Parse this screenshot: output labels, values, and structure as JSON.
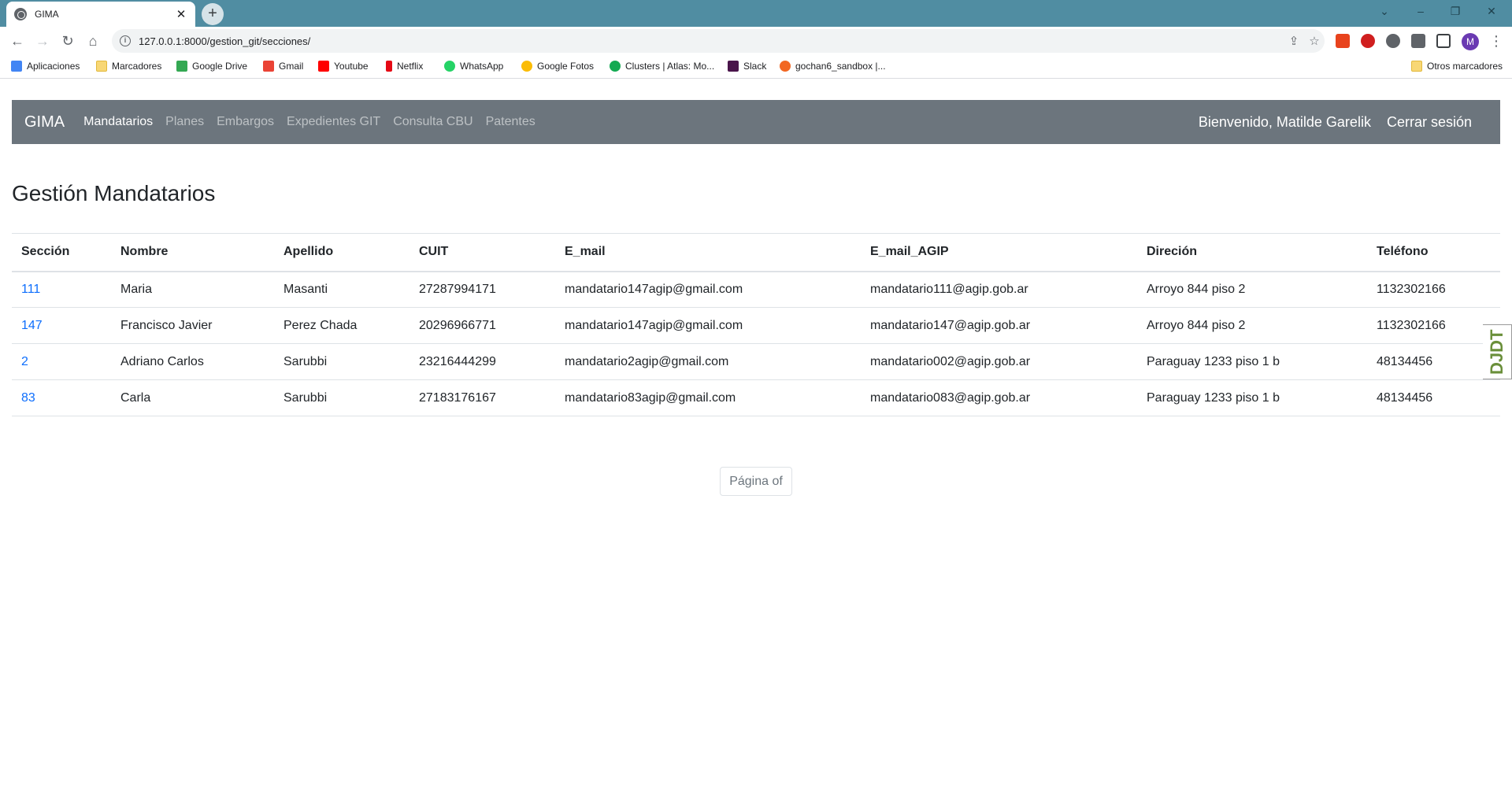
{
  "browser": {
    "tab_title": "GIMA",
    "tab_close": "✕",
    "new_tab": "+",
    "url": "127.0.0.1:8000/gestion_git/secciones/",
    "profile_initial": "M",
    "bookmarks": [
      {
        "label": "Aplicaciones",
        "icon": "apps-grid-icon",
        "color": "#4285f4"
      },
      {
        "label": "Marcadores",
        "icon": "folder-icon",
        "color": "#f8d775"
      },
      {
        "label": "Google Drive",
        "icon": "google-drive-icon",
        "color": "#34a853"
      },
      {
        "label": "Gmail",
        "icon": "gmail-icon",
        "color": "#ea4335"
      },
      {
        "label": "Youtube",
        "icon": "youtube-icon",
        "color": "#ff0000"
      },
      {
        "label": "Netflix",
        "icon": "netflix-icon",
        "color": "#e50914"
      },
      {
        "label": "WhatsApp",
        "icon": "whatsapp-icon",
        "color": "#25d366"
      },
      {
        "label": "Google Fotos",
        "icon": "google-photos-icon",
        "color": "#fbbc05"
      },
      {
        "label": "Clusters | Atlas: Mo...",
        "icon": "mongodb-icon",
        "color": "#13aa52"
      },
      {
        "label": "Slack",
        "icon": "slack-icon",
        "color": "#4a154b"
      },
      {
        "label": "gochan6_sandbox |...",
        "icon": "cp-icon",
        "color": "#f26722"
      }
    ],
    "other_bookmarks": "Otros marcadores"
  },
  "navbar": {
    "brand": "GIMA",
    "links": [
      {
        "label": "Mandatarios",
        "active": true
      },
      {
        "label": "Planes",
        "active": false
      },
      {
        "label": "Embargos",
        "active": false
      },
      {
        "label": "Expedientes GIT",
        "active": false
      },
      {
        "label": "Consulta CBU",
        "active": false
      },
      {
        "label": "Patentes",
        "active": false
      }
    ],
    "welcome": "Bienvenido, Matilde Garelik",
    "logout": "Cerrar sesión"
  },
  "page": {
    "title": "Gestión Mandatarios",
    "pager": "Página of",
    "debug_toolbar": "DJDT"
  },
  "table": {
    "headers": [
      "Sección",
      "Nombre",
      "Apellido",
      "CUIT",
      "E_mail",
      "E_mail_AGIP",
      "Direción",
      "Teléfono"
    ],
    "rows": [
      [
        "111",
        "Maria",
        "Masanti",
        "27287994171",
        "mandatario147agip@gmail.com",
        "mandatario111@agip.gob.ar",
        "Arroyo 844 piso 2",
        "1132302166"
      ],
      [
        "147",
        "Francisco Javier",
        "Perez Chada",
        "20296966771",
        "mandatario147agip@gmail.com",
        "mandatario147@agip.gob.ar",
        "Arroyo 844 piso 2",
        "1132302166"
      ],
      [
        "2",
        "Adriano Carlos",
        "Sarubbi",
        "23216444299",
        "mandatario2agip@gmail.com",
        "mandatario002@agip.gob.ar",
        "Paraguay 1233 piso 1 b",
        "48134456"
      ],
      [
        "83",
        "Carla",
        "Sarubbi",
        "27183176167",
        "mandatario83agip@gmail.com",
        "mandatario083@agip.gob.ar",
        "Paraguay 1233 piso 1 b",
        "48134456"
      ]
    ]
  },
  "colors": {
    "tabstrip": "#508da2",
    "navbar": "#6c757d",
    "link": "#0d6efd"
  }
}
